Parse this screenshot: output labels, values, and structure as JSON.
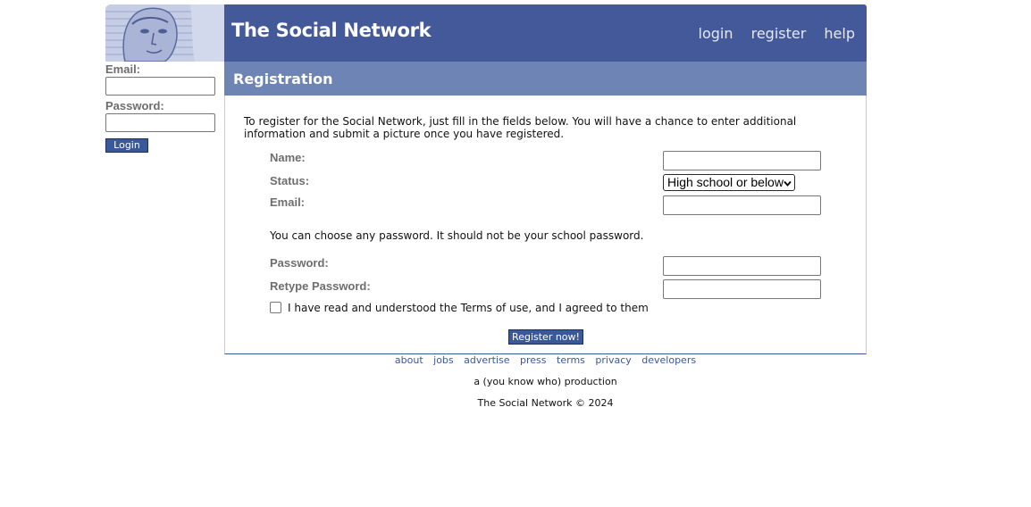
{
  "header": {
    "title": "The Social Network",
    "nav": [
      "login",
      "register",
      "help"
    ]
  },
  "sidebar": {
    "email_label": "Email:",
    "password_label": "Password:",
    "login_button": "Login"
  },
  "registration": {
    "heading": "Registration",
    "intro": "To register for the Social Network, just fill in the fields below. You will have a chance to enter additional information and submit a picture once you have registered.",
    "name_label": "Name:",
    "status_label": "Status:",
    "status_value": "High school or below",
    "email_label": "Email:",
    "password_note": "You can choose any password. It should not be your school password.",
    "password_label": "Password:",
    "retype_label": "Retype Password:",
    "terms_text": "I have read and understood the Terms of use, and I agreed to them",
    "register_button": "Register now!"
  },
  "footer": {
    "links": [
      "about",
      "jobs",
      "advertise",
      "press",
      "terms",
      "privacy",
      "developers"
    ],
    "tagline": "a (you know who) production",
    "copyright": "The Social Network © 2024"
  },
  "colors": {
    "header_blue": "#44599a",
    "subheader_blue": "#6d84b4",
    "button_blue": "#3b5998",
    "label_gray": "#6d6d6d"
  }
}
